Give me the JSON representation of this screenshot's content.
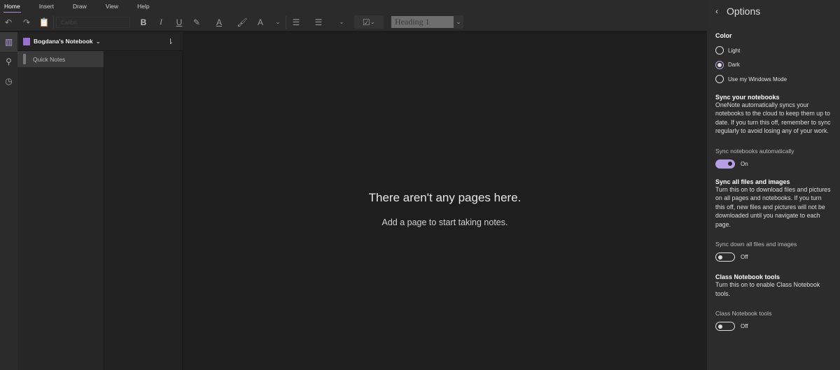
{
  "menu": [
    "Home",
    "Insert",
    "Draw",
    "View",
    "Help"
  ],
  "toolbar": {
    "font_placeholder": "Calibri",
    "style_value": "Heading 1"
  },
  "notebook": {
    "name": "Bogdana's Notebook",
    "sections": [
      "Quick Notes"
    ]
  },
  "empty": {
    "title": "There aren't any pages here.",
    "subtitle": "Add a page to start taking notes."
  },
  "options": {
    "title": "Options",
    "color_heading": "Color",
    "color_options": [
      "Light",
      "Dark",
      "Use my Windows Mode"
    ],
    "color_selected": "Dark",
    "sync_heading": "Sync your notebooks",
    "sync_text": "OneNote automatically syncs your notebooks to the cloud to keep them up to date. If you turn this off, remember to sync regularly to avoid losing any of your work.",
    "sync_label": "Sync notebooks automatically",
    "sync_state": "On",
    "files_heading": "Sync all files and images",
    "files_text": "Turn this on to download files and pictures on all pages and notebooks. If you turn this off, new files and pictures will not be downloaded until you navigate to each page.",
    "files_label": "Sync down all files and images",
    "files_state": "Off",
    "class_heading": "Class Notebook tools",
    "class_text": "Turn this on to enable Class Notebook tools.",
    "class_label": "Class Notebook tools",
    "class_state": "Off"
  },
  "colors": {
    "accent": "#b79de3"
  }
}
